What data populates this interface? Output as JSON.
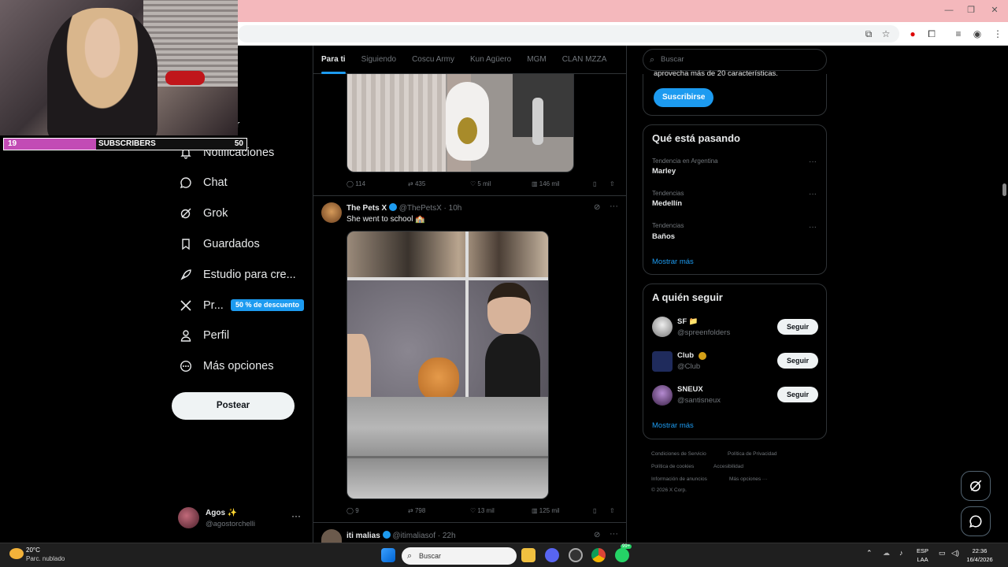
{
  "stream": {
    "sub_count": "19",
    "sub_label": "SUBSCRIBERS",
    "sub_goal": "50",
    "sub_progress": 0.38
  },
  "nav": {
    "items": [
      {
        "label": "Notificaciones",
        "icon": "bell-icon"
      },
      {
        "label": "Chat",
        "icon": "chat-icon"
      },
      {
        "label": "Grok",
        "icon": "grok-icon"
      },
      {
        "label": "Guardados",
        "icon": "bookmark-icon"
      },
      {
        "label": "Estudio para cre...",
        "icon": "rocket-icon"
      },
      {
        "label": "Pr...",
        "icon": "x-logo-icon"
      },
      {
        "label": "Perfil",
        "icon": "person-icon"
      },
      {
        "label": "Más opciones",
        "icon": "more-circle-icon"
      }
    ],
    "partial_label": "r",
    "premium_badge": "50 % de descuento",
    "post_button": "Postear",
    "account_name": "Agos ✨",
    "account_handle": "@agostorchelli"
  },
  "tabs": [
    "Para ti",
    "Siguiendo",
    "Coscu Army",
    "Kun Agüero",
    "MGM",
    "CLAN MZZA"
  ],
  "tweets": [
    {
      "stats": {
        "replies": "114",
        "retweets": "435",
        "likes": "5 mil",
        "views": "146 mil"
      }
    },
    {
      "name": "The Pets X",
      "handle": "@ThePetsX",
      "time": "· 10h",
      "text": "She went to school 🏫",
      "stats": {
        "replies": "9",
        "retweets": "798",
        "likes": "13 mil",
        "views": "125 mil"
      }
    },
    {
      "name": "iti malias",
      "handle": "@itimaliasof",
      "time": "· 22h"
    }
  ],
  "right": {
    "search_placeholder": "Buscar",
    "premium_text": "aprovecha más de 20 características.",
    "subscribe_button": "Suscribirse",
    "trends_title": "Qué está pasando",
    "trends": [
      {
        "category": "Tendencia en Argentina",
        "name": "Marley"
      },
      {
        "category": "Tendencias",
        "name": "Medellín"
      },
      {
        "category": "Tendencias",
        "name": "Baños"
      }
    ],
    "show_more": "Mostrar más",
    "follow_title": "A quién seguir",
    "follow": [
      {
        "name": "SF 📁",
        "handle": "@spreenfolders",
        "button": "Seguir"
      },
      {
        "name": "Club",
        "handle": "@Club",
        "button": "Seguir"
      },
      {
        "name": "SNEUX",
        "handle": "@santisneux",
        "button": "Seguir"
      }
    ],
    "follow_more": "Mostrar más",
    "footer": {
      "terms": "Condiciones de Servicio",
      "privacy": "Política de Privacidad",
      "cookies": "Política de cookies",
      "access": "Accesibilidad",
      "ads": "Información de anuncios",
      "more": "Más opciones ···",
      "copy": "© 2026 X Corp."
    }
  },
  "taskbar": {
    "temp": "20°C",
    "weather": "Parc. nublado",
    "search": "Buscar",
    "lang1": "ESP",
    "lang2": "LAA",
    "time": "22:36",
    "date": "16/4/2026",
    "whatsapp_badge": "99+"
  },
  "colors": {
    "accent": "#1d9bf0",
    "titlebar": "#f4b8bc",
    "background": "#000000"
  }
}
